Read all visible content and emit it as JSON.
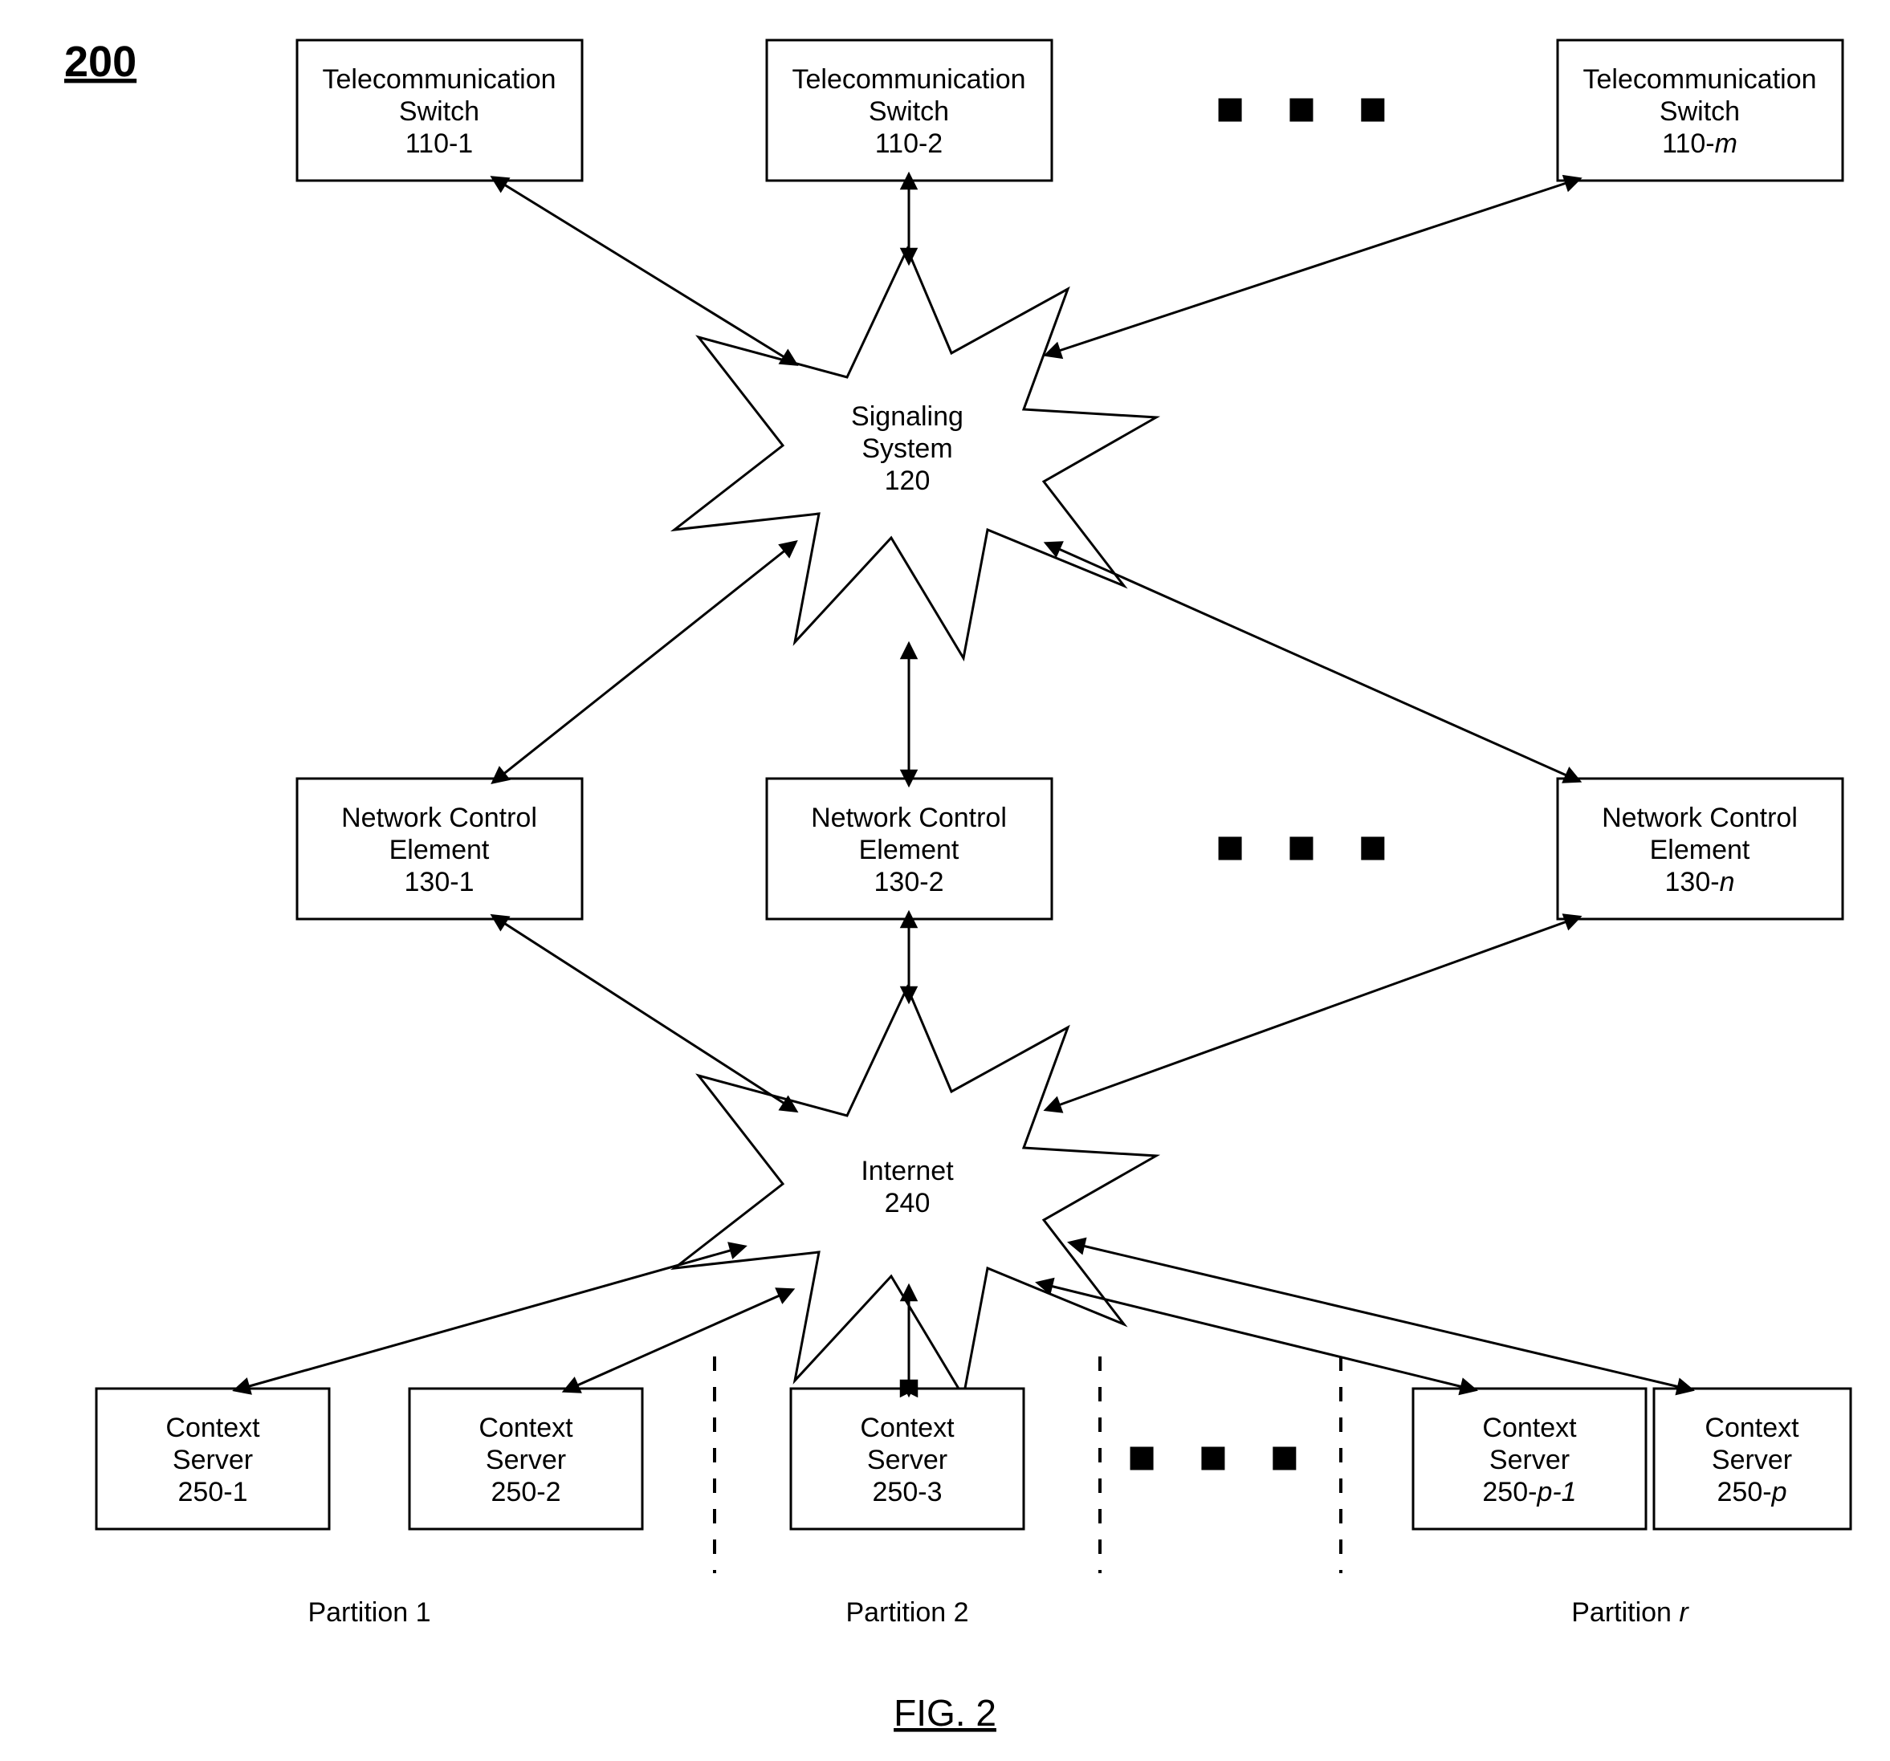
{
  "figure_ref": "200",
  "caption": "FIG. 2",
  "switches": [
    {
      "line1": "Telecommunication",
      "line2": "Switch",
      "line3": "110-1"
    },
    {
      "line1": "Telecommunication",
      "line2": "Switch",
      "line3": "110-2"
    },
    {
      "line1": "Telecommunication",
      "line2": "Switch",
      "line3_prefix": "110-",
      "line3_var": "m"
    }
  ],
  "signaling": {
    "line1": "Signaling",
    "line2": "System",
    "line3": "120"
  },
  "nces": [
    {
      "line1": "Network Control",
      "line2": "Element",
      "line3": "130-1"
    },
    {
      "line1": "Network Control",
      "line2": "Element",
      "line3": "130-2"
    },
    {
      "line1": "Network Control",
      "line2": "Element",
      "line3_prefix": "130-",
      "line3_var": "n"
    }
  ],
  "internet": {
    "line1": "Internet",
    "line2": "240"
  },
  "servers": [
    {
      "line1": "Context",
      "line2": "Server",
      "line3": "250-1"
    },
    {
      "line1": "Context",
      "line2": "Server",
      "line3": "250-2"
    },
    {
      "line1": "Context",
      "line2": "Server",
      "line3": "250-3"
    },
    {
      "line1": "Context",
      "line2": "Server",
      "line3_prefix": "250-",
      "line3_var": "p-1"
    },
    {
      "line1": "Context",
      "line2": "Server",
      "line3_prefix": "250-",
      "line3_var": "p"
    }
  ],
  "partitions": {
    "p1": "Partition 1",
    "p2": "Partition 2",
    "pr_prefix": "Partition ",
    "pr_var": "r"
  },
  "ellipsis": "■ ■ ■"
}
